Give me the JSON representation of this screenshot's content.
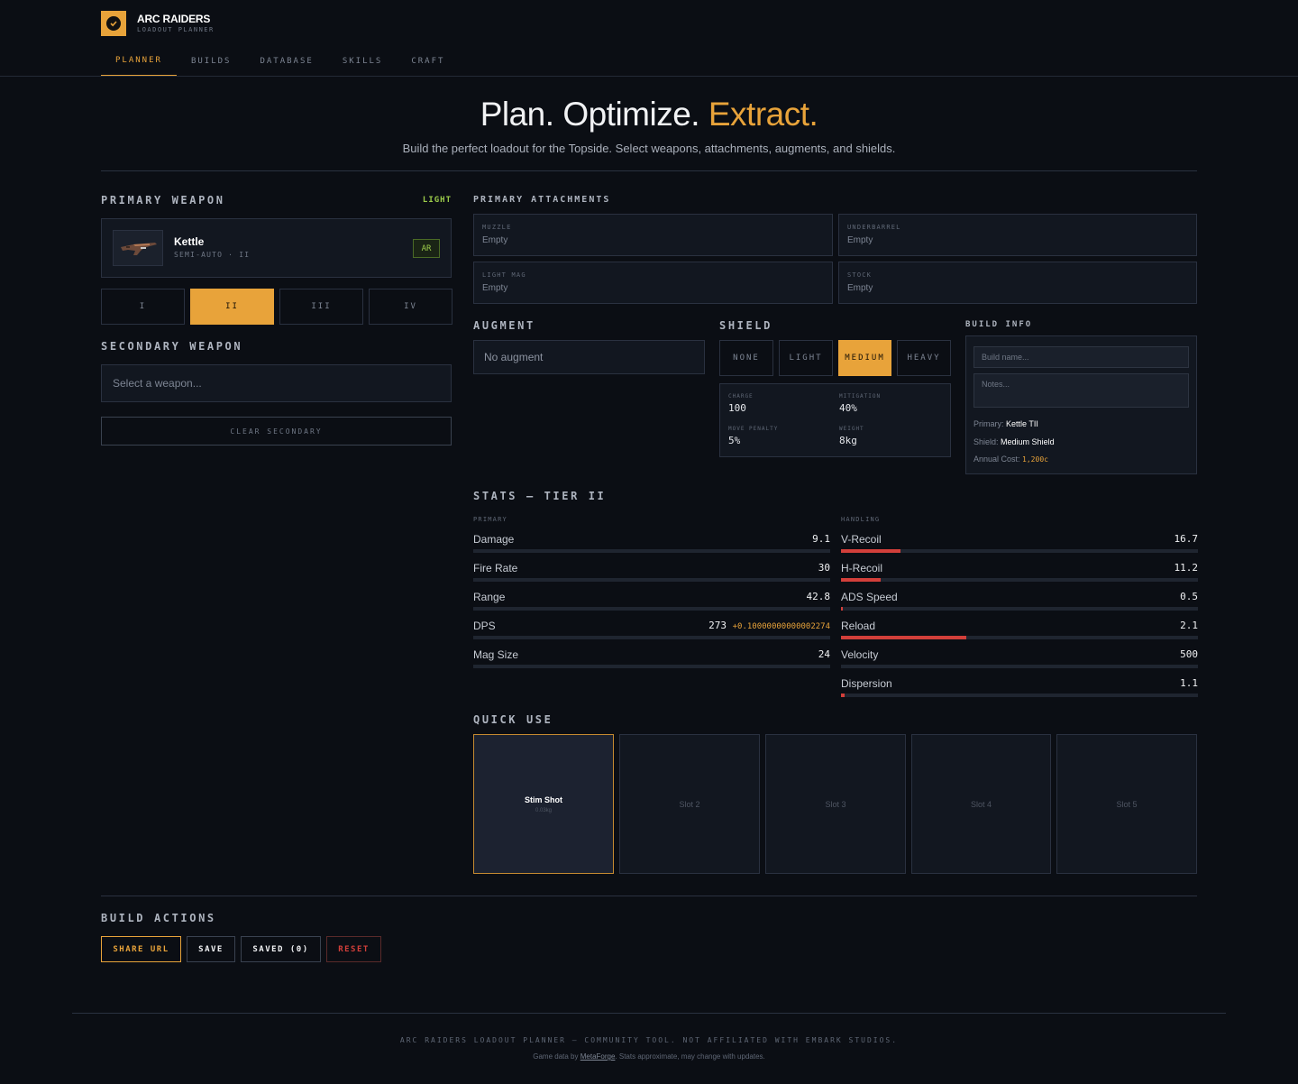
{
  "app": {
    "title": "ARC RAIDERS",
    "subtitle": "LOADOUT PLANNER"
  },
  "nav": {
    "tabs": [
      "PLANNER",
      "BUILDS",
      "DATABASE",
      "SKILLS",
      "CRAFT"
    ],
    "active": "PLANNER"
  },
  "hero": {
    "title_main": "Plan. Optimize.",
    "title_accent": "Extract.",
    "subtitle": "Build the perfect loadout for the Topside. Select weapons, attachments, augments, and shields."
  },
  "primary": {
    "label": "PRIMARY WEAPON",
    "weight_class": "LIGHT",
    "weapon_name": "Kettle",
    "weapon_meta": "SEMI-AUTO · II",
    "weapon_type": "AR",
    "tiers": [
      "I",
      "II",
      "III",
      "IV"
    ],
    "active_tier": "II"
  },
  "secondary": {
    "label": "SECONDARY WEAPON",
    "placeholder": "Select a weapon...",
    "clear_label": "CLEAR SECONDARY"
  },
  "attachments": {
    "label": "PRIMARY ATTACHMENTS",
    "slots": [
      {
        "label": "MUZZLE",
        "value": "Empty"
      },
      {
        "label": "UNDERBARREL",
        "value": "Empty"
      },
      {
        "label": "LIGHT MAG",
        "value": "Empty"
      },
      {
        "label": "STOCK",
        "value": "Empty"
      }
    ]
  },
  "augment": {
    "label": "AUGMENT",
    "value": "No augment"
  },
  "shield": {
    "label": "SHIELD",
    "options": [
      "NONE",
      "LIGHT",
      "MEDIUM",
      "HEAVY"
    ],
    "active": "MEDIUM",
    "stats": {
      "charge_label": "CHARGE",
      "charge": "100",
      "mitigation_label": "MITIGATION",
      "mitigation": "40%",
      "move_penalty_label": "MOVE PENALTY",
      "move_penalty": "5%",
      "weight_label": "WEIGHT",
      "weight": "8kg"
    }
  },
  "build_info": {
    "label": "BUILD INFO",
    "name_placeholder": "Build name...",
    "notes_placeholder": "Notes...",
    "primary_label": "Primary:",
    "primary_value": "Kettle TII",
    "shield_label": "Shield:",
    "shield_value": "Medium Shield",
    "cost_label": "Annual Cost:",
    "cost_value": "1,200c"
  },
  "stats": {
    "label": "STATS — TIER II",
    "primary_label": "PRIMARY",
    "handling_label": "HANDLING",
    "primary_stats": [
      {
        "name": "Damage",
        "value": "9.1",
        "fill": 0
      },
      {
        "name": "Fire Rate",
        "value": "30",
        "fill": 0
      },
      {
        "name": "Range",
        "value": "42.8",
        "fill": 0
      },
      {
        "name": "DPS",
        "value": "273",
        "bonus": "+0.10000000000002274",
        "fill": 0
      },
      {
        "name": "Mag Size",
        "value": "24",
        "fill": 0
      }
    ],
    "handling_stats": [
      {
        "name": "V-Recoil",
        "value": "16.7",
        "fill": 0.167
      },
      {
        "name": "H-Recoil",
        "value": "11.2",
        "fill": 0.112
      },
      {
        "name": "ADS Speed",
        "value": "0.5",
        "fill": 0.005
      },
      {
        "name": "Reload",
        "value": "2.1",
        "fill": 0.35
      },
      {
        "name": "Velocity",
        "value": "500",
        "fill": 0
      },
      {
        "name": "Dispersion",
        "value": "1.1",
        "fill": 0.011
      }
    ]
  },
  "quick_use": {
    "label": "QUICK USE",
    "slots": [
      {
        "name": "Stim Shot",
        "sub": "0.03kg",
        "filled": true
      },
      {
        "name": "Slot 2",
        "filled": false
      },
      {
        "name": "Slot 3",
        "filled": false
      },
      {
        "name": "Slot 4",
        "filled": false
      },
      {
        "name": "Slot 5",
        "filled": false
      }
    ]
  },
  "actions": {
    "label": "BUILD ACTIONS",
    "share": "SHARE URL",
    "save": "SAVE",
    "saved": "SAVED (0)",
    "reset": "RESET"
  },
  "footer": {
    "line1": "ARC RAIDERS LOADOUT PLANNER — COMMUNITY TOOL. NOT AFFILIATED WITH EMBARK STUDIOS.",
    "line2_prefix": "Game data by",
    "line2_link": "MetaForge",
    "line2_suffix": ". Stats approximate, may change with updates."
  },
  "colors": {
    "accent": "#e8a33a",
    "bar_red": "#d23f3a",
    "bg": "#0b0e14",
    "panel": "#121720"
  }
}
